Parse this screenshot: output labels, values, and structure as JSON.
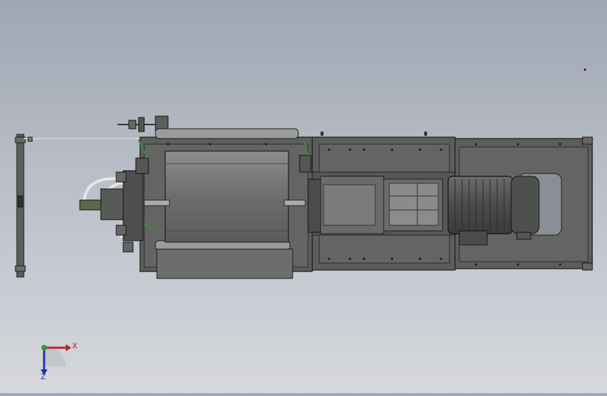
{
  "viewport": {
    "background_top": "#9fa6b2",
    "background_bottom": "#d6d8dd",
    "model_fill": "#5c5e5c",
    "model_edge": "#1c1c1c",
    "drum_fill": "#6f716f",
    "hose_color": "#e6e6e6",
    "accent_green": "#3c8a3c"
  },
  "triad": {
    "x_label": "X",
    "z_label": "Z",
    "x_color": "#c0202a",
    "y_color": "#2aa02a",
    "z_color": "#2030b0"
  },
  "icons": [
    "triad-icon",
    "origin-icon"
  ]
}
